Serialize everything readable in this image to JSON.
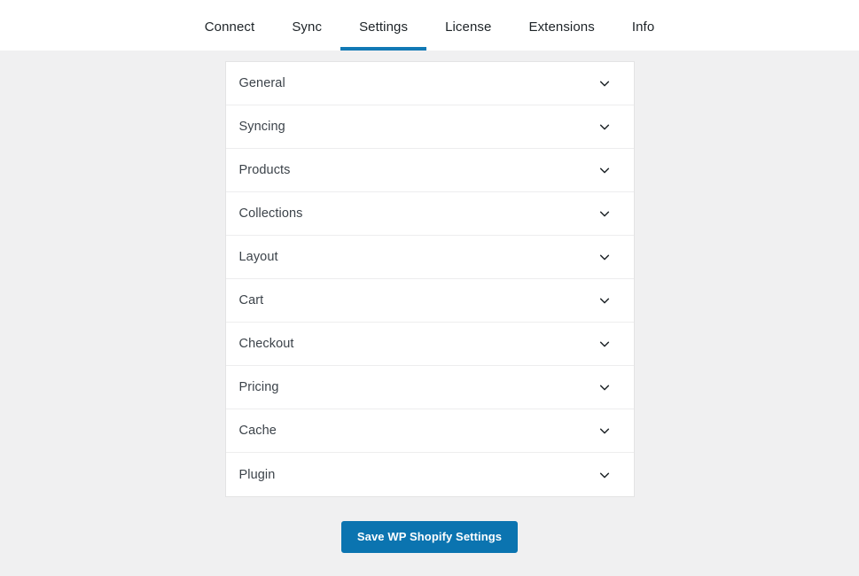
{
  "header": {
    "tabs": [
      {
        "label": "Connect",
        "active": false
      },
      {
        "label": "Sync",
        "active": false
      },
      {
        "label": "Settings",
        "active": true
      },
      {
        "label": "License",
        "active": false
      },
      {
        "label": "Extensions",
        "active": false
      },
      {
        "label": "Info",
        "active": false
      }
    ]
  },
  "settings": {
    "sections": [
      {
        "label": "General",
        "icon": "chevron-down-icon",
        "expanded": false
      },
      {
        "label": "Syncing",
        "icon": "chevron-down-icon",
        "expanded": false
      },
      {
        "label": "Products",
        "icon": "chevron-down-icon",
        "expanded": false
      },
      {
        "label": "Collections",
        "icon": "chevron-down-icon",
        "expanded": false
      },
      {
        "label": "Layout",
        "icon": "chevron-down-icon",
        "expanded": false
      },
      {
        "label": "Cart",
        "icon": "chevron-down-icon",
        "expanded": false
      },
      {
        "label": "Checkout",
        "icon": "chevron-down-icon",
        "expanded": false
      },
      {
        "label": "Pricing",
        "icon": "chevron-down-icon",
        "expanded": false
      },
      {
        "label": "Cache",
        "icon": "chevron-down-icon",
        "expanded": false
      },
      {
        "label": "Plugin",
        "icon": "chevron-down-icon",
        "expanded": false
      }
    ]
  },
  "footer": {
    "save_label": "Save WP Shopify Settings"
  },
  "colors": {
    "accent": "#1179b5",
    "button": "#0b74b0",
    "page_background": "#f0f0f1",
    "panel_background": "#ffffff",
    "text": "#3c434a",
    "divider": "#ededee"
  }
}
